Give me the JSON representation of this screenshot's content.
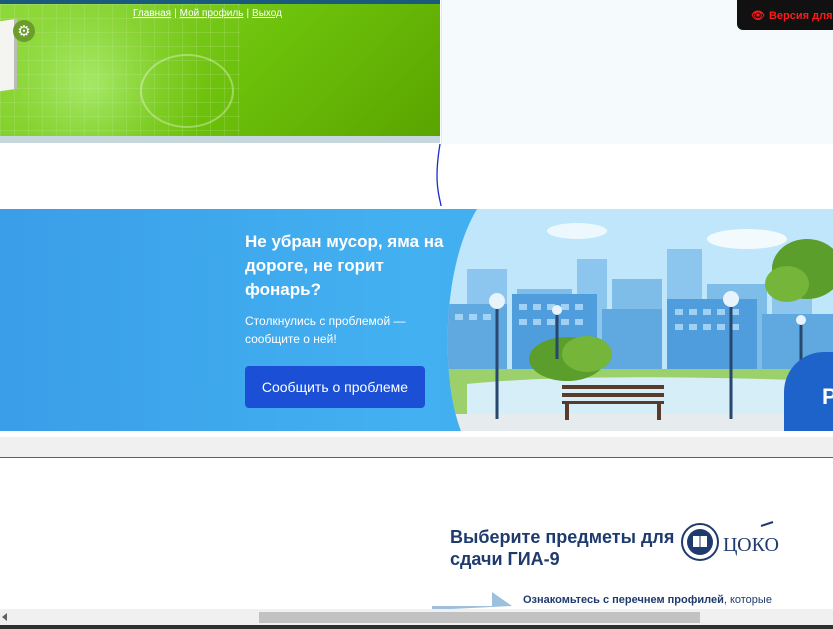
{
  "header": {
    "nav": [
      {
        "label": "Главная"
      },
      {
        "label": "Мой профиль"
      },
      {
        "label": "Выход"
      }
    ],
    "separator": "|",
    "accessibility_label": "Версия для",
    "settings_icon": "gear-icon",
    "accessibility_icon": "eye-icon"
  },
  "promo": {
    "title": "Не убран мусор, яма на дороге, не горит фонарь?",
    "subtitle": "Столкнулись с проблемой — сообщите о ней!",
    "button_label": "Сообщить о проблеме",
    "partial_text": "Р"
  },
  "gia": {
    "title": "Выберите предметы для сдачи ГИА-9",
    "logo_text": "ЦОКО",
    "note_bold": "Ознакомьтесь с перечнем профилей",
    "note_rest": ", которые"
  },
  "colors": {
    "header_green": "#6cc10a",
    "promo_blue": "#43b1f1",
    "button_blue": "#1a4fd6",
    "gia_navy": "#1f3b6e",
    "accessibility_red": "#ff1a1a"
  }
}
